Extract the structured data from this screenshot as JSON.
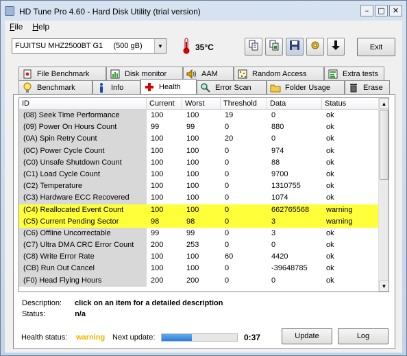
{
  "window": {
    "title": "HD Tune Pro 4.60 - Hard Disk Utility (trial version)",
    "controls": [
      "–",
      "□",
      "✕"
    ]
  },
  "menu": [
    {
      "label": "File",
      "accel": "F",
      "rest": "ile"
    },
    {
      "label": "Help",
      "accel": "H",
      "rest": "elp"
    }
  ],
  "toolbar": {
    "drive": "FUJITSU MHZ2500BT G1     (500 gB)",
    "temperature": "35°C",
    "exit_label": "Exit"
  },
  "tabs": {
    "row1": [
      {
        "label": "File Benchmark",
        "icon": "file-benchmark-icon"
      },
      {
        "label": "Disk monitor",
        "icon": "disk-monitor-icon"
      },
      {
        "label": "AAM",
        "icon": "speaker-icon"
      },
      {
        "label": "Random Access",
        "icon": "random-access-icon"
      },
      {
        "label": "Extra tests",
        "icon": "extra-tests-icon"
      }
    ],
    "row2": [
      {
        "label": "Benchmark",
        "icon": "bulb-icon"
      },
      {
        "label": "Info",
        "icon": "info-icon"
      },
      {
        "label": "Health",
        "icon": "health-cross-icon",
        "active": true
      },
      {
        "label": "Error Scan",
        "icon": "magnifier-icon"
      },
      {
        "label": "Folder Usage",
        "icon": "folder-icon"
      },
      {
        "label": "Erase",
        "icon": "trash-icon"
      }
    ]
  },
  "smart": {
    "columns": [
      "ID",
      "Current",
      "Worst",
      "Threshold",
      "Data",
      "Status"
    ],
    "rows": [
      {
        "id": "(08) Seek Time Performance",
        "current": "100",
        "worst": "100",
        "threshold": "19",
        "data": "0",
        "status": "ok"
      },
      {
        "id": "(09) Power On Hours Count",
        "current": "99",
        "worst": "99",
        "threshold": "0",
        "data": "880",
        "status": "ok"
      },
      {
        "id": "(0A) Spin Retry Count",
        "current": "100",
        "worst": "100",
        "threshold": "20",
        "data": "0",
        "status": "ok"
      },
      {
        "id": "(0C) Power Cycle Count",
        "current": "100",
        "worst": "100",
        "threshold": "0",
        "data": "974",
        "status": "ok"
      },
      {
        "id": "(C0) Unsafe Shutdown Count",
        "current": "100",
        "worst": "100",
        "threshold": "0",
        "data": "88",
        "status": "ok"
      },
      {
        "id": "(C1) Load Cycle Count",
        "current": "100",
        "worst": "100",
        "threshold": "0",
        "data": "9700",
        "status": "ok"
      },
      {
        "id": "(C2) Temperature",
        "current": "100",
        "worst": "100",
        "threshold": "0",
        "data": "1310755",
        "status": "ok"
      },
      {
        "id": "(C3) Hardware ECC Recovered",
        "current": "100",
        "worst": "100",
        "threshold": "0",
        "data": "1074",
        "status": "ok"
      },
      {
        "id": "(C4) Reallocated Event Count",
        "current": "100",
        "worst": "100",
        "threshold": "0",
        "data": "662765568",
        "status": "warning",
        "warn": true
      },
      {
        "id": "(C5) Current Pending Sector",
        "current": "98",
        "worst": "98",
        "threshold": "0",
        "data": "3",
        "status": "warning",
        "warn": true
      },
      {
        "id": "(C6) Offline Uncorrectable",
        "current": "99",
        "worst": "99",
        "threshold": "0",
        "data": "3",
        "status": "ok"
      },
      {
        "id": "(C7) Ultra DMA CRC Error Count",
        "current": "200",
        "worst": "253",
        "threshold": "0",
        "data": "0",
        "status": "ok"
      },
      {
        "id": "(C8) Write Error Rate",
        "current": "100",
        "worst": "100",
        "threshold": "60",
        "data": "4420",
        "status": "ok"
      },
      {
        "id": "(CB) Run Out Cancel",
        "current": "100",
        "worst": "100",
        "threshold": "0",
        "data": "-39648785",
        "status": "ok"
      },
      {
        "id": "(F0) Head Flying Hours",
        "current": "200",
        "worst": "200",
        "threshold": "0",
        "data": "0",
        "status": "ok"
      }
    ]
  },
  "description": {
    "label": "Description:",
    "value": "click on an item for a detailed description",
    "status_label": "Status:",
    "status_value": "n/a"
  },
  "footer": {
    "health_label": "Health status:",
    "health_value": "warning",
    "health_color": "#f0b400",
    "next_label": "Next update:",
    "progress_fraction": 0.4,
    "next_time": "0:37",
    "update_label": "Update",
    "log_label": "Log"
  },
  "colors": {
    "warning_row": "#ffff3a",
    "progress": "#2b7fd8"
  }
}
